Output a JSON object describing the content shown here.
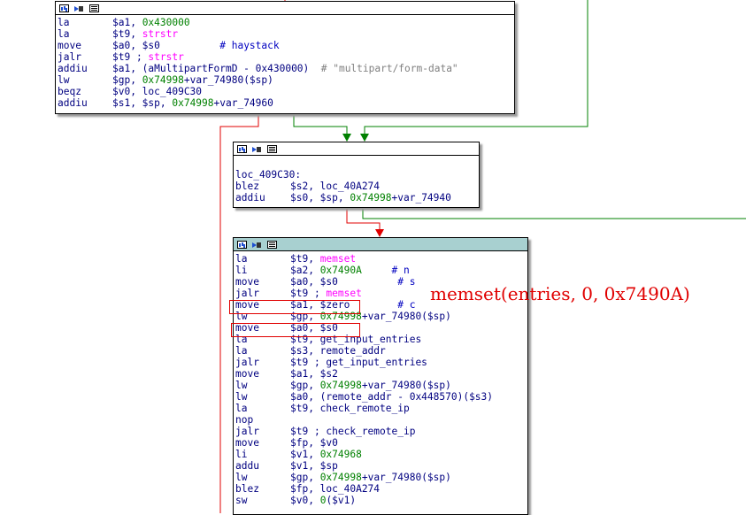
{
  "block1": {
    "lines": [
      {
        "m": "la",
        "o": [
          {
            "t": "$a1, ",
            "c": "op"
          },
          {
            "t": "0x430000",
            "c": "num"
          }
        ]
      },
      {
        "m": "la",
        "o": [
          {
            "t": "$t9, ",
            "c": "op"
          },
          {
            "t": "strstr",
            "c": "fn"
          }
        ]
      },
      {
        "m": "move",
        "o": [
          {
            "t": "$a0, $s0          ",
            "c": "op"
          },
          {
            "t": "# haystack",
            "c": "cm"
          }
        ]
      },
      {
        "m": "jalr",
        "o": [
          {
            "t": "$t9 ; ",
            "c": "op"
          },
          {
            "t": "strstr",
            "c": "fn"
          }
        ]
      },
      {
        "m": "addiu",
        "o": [
          {
            "t": "$a1, (aMultipartFormD - 0x430000)  ",
            "c": "op"
          },
          {
            "t": "# \"multipart/form-data\"",
            "c": "str"
          }
        ]
      },
      {
        "m": "lw",
        "o": [
          {
            "t": "$gp, ",
            "c": "op"
          },
          {
            "t": "0x74998",
            "c": "num"
          },
          {
            "t": "+var_74980($sp)",
            "c": "op"
          }
        ]
      },
      {
        "m": "beqz",
        "o": [
          {
            "t": "$v0, loc_409C30",
            "c": "op"
          }
        ]
      },
      {
        "m": "addiu",
        "o": [
          {
            "t": "$s1, $sp, ",
            "c": "op"
          },
          {
            "t": "0x74998",
            "c": "num"
          },
          {
            "t": "+var_74960",
            "c": "op"
          }
        ]
      }
    ]
  },
  "block2": {
    "lines": [
      {
        "m": "",
        "o": []
      },
      {
        "m": "loc_409C30:",
        "o": [],
        "label": true
      },
      {
        "m": "blez",
        "o": [
          {
            "t": "$s2, loc_40A274",
            "c": "op"
          }
        ]
      },
      {
        "m": "addiu",
        "o": [
          {
            "t": "$s0, $sp, ",
            "c": "op"
          },
          {
            "t": "0x74998",
            "c": "num"
          },
          {
            "t": "+var_74940",
            "c": "op"
          }
        ]
      }
    ]
  },
  "block3": {
    "lines": [
      {
        "m": "la",
        "o": [
          {
            "t": "$t9, ",
            "c": "op"
          },
          {
            "t": "memset",
            "c": "fn"
          }
        ]
      },
      {
        "m": "li",
        "o": [
          {
            "t": "$a2, ",
            "c": "op"
          },
          {
            "t": "0x7490A",
            "c": "num"
          },
          {
            "t": "     ",
            "c": "op"
          },
          {
            "t": "# n",
            "c": "cm"
          }
        ]
      },
      {
        "m": "move",
        "o": [
          {
            "t": "$a0, $s0          ",
            "c": "op"
          },
          {
            "t": "# s",
            "c": "cm"
          }
        ]
      },
      {
        "m": "jalr",
        "o": [
          {
            "t": "$t9 ; ",
            "c": "op"
          },
          {
            "t": "memset",
            "c": "fn"
          }
        ]
      },
      {
        "m": "move",
        "o": [
          {
            "t": "$a1, $zero        ",
            "c": "op"
          },
          {
            "t": "# c",
            "c": "cm"
          }
        ]
      },
      {
        "m": "lw",
        "o": [
          {
            "t": "$gp, ",
            "c": "op"
          },
          {
            "t": "0x74998",
            "c": "num"
          },
          {
            "t": "+var_74980($sp)",
            "c": "op"
          }
        ]
      },
      {
        "m": "move",
        "o": [
          {
            "t": "$a0, $s0",
            "c": "op"
          }
        ]
      },
      {
        "m": "la",
        "o": [
          {
            "t": "$t9, get_input_entries",
            "c": "op"
          }
        ]
      },
      {
        "m": "la",
        "o": [
          {
            "t": "$s3, remote_addr",
            "c": "op"
          }
        ]
      },
      {
        "m": "jalr",
        "o": [
          {
            "t": "$t9 ; get_input_entries",
            "c": "op"
          }
        ]
      },
      {
        "m": "move",
        "o": [
          {
            "t": "$a1, $s2",
            "c": "op"
          }
        ]
      },
      {
        "m": "lw",
        "o": [
          {
            "t": "$gp, ",
            "c": "op"
          },
          {
            "t": "0x74998",
            "c": "num"
          },
          {
            "t": "+var_74980($sp)",
            "c": "op"
          }
        ]
      },
      {
        "m": "lw",
        "o": [
          {
            "t": "$a0, (remote_addr - 0x448570)($s3)",
            "c": "op"
          }
        ]
      },
      {
        "m": "la",
        "o": [
          {
            "t": "$t9, check_remote_ip",
            "c": "op"
          }
        ]
      },
      {
        "m": "nop",
        "o": []
      },
      {
        "m": "jalr",
        "o": [
          {
            "t": "$t9 ; check_remote_ip",
            "c": "op"
          }
        ]
      },
      {
        "m": "move",
        "o": [
          {
            "t": "$fp, $v0",
            "c": "op"
          }
        ]
      },
      {
        "m": "li",
        "o": [
          {
            "t": "$v1, ",
            "c": "op"
          },
          {
            "t": "0x74968",
            "c": "num"
          }
        ]
      },
      {
        "m": "addu",
        "o": [
          {
            "t": "$v1, $sp",
            "c": "op"
          }
        ]
      },
      {
        "m": "lw",
        "o": [
          {
            "t": "$gp, ",
            "c": "op"
          },
          {
            "t": "0x74998",
            "c": "num"
          },
          {
            "t": "+var_74980($sp)",
            "c": "op"
          }
        ]
      },
      {
        "m": "blez",
        "o": [
          {
            "t": "$fp, loc_40A274",
            "c": "op"
          }
        ]
      },
      {
        "m": "sw",
        "o": [
          {
            "t": "$v0, ",
            "c": "op"
          },
          {
            "t": "0",
            "c": "num"
          },
          {
            "t": "($v1)",
            "c": "op"
          }
        ]
      }
    ]
  },
  "annotation": "memset(entries, 0, 0x7490A)",
  "colors": {
    "true_edge": "#008000",
    "false_edge": "#e00000",
    "selected_header": "#a8d0d0"
  },
  "icons": [
    "graph-icon",
    "favorite-icon",
    "listing-icon"
  ]
}
